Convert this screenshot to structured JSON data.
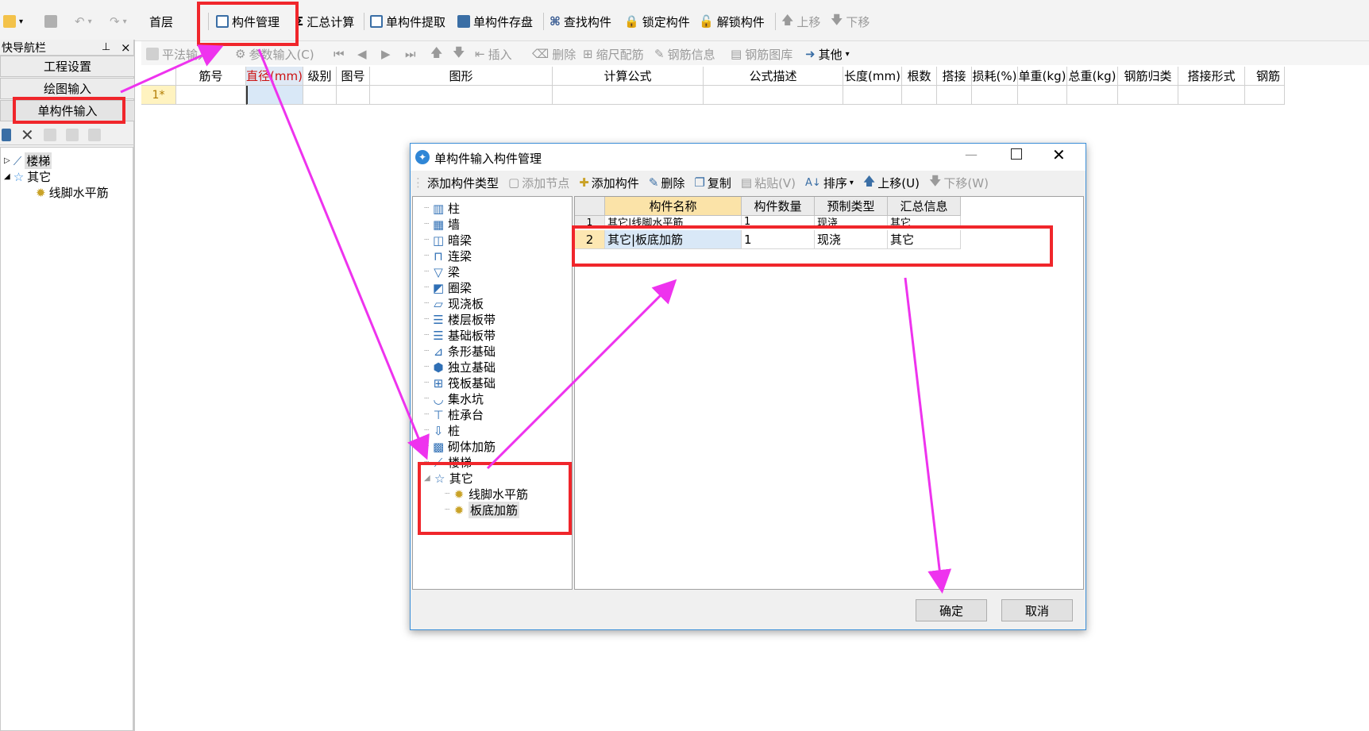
{
  "toolbar": {
    "floor": "首层",
    "component_manage": "构件管理",
    "summary_calc": "汇总计算",
    "single_extract": "单构件提取",
    "single_save": "单构件存盘",
    "find_component": "查找构件",
    "lock_component": "锁定构件",
    "unlock_component": "解锁构件",
    "move_up": "上移",
    "move_down": "下移"
  },
  "nav": {
    "title": "快导航栏",
    "pin": "ᵖ",
    "close": "×",
    "items": [
      "工程设置",
      "绘图输入",
      "单构件输入"
    ],
    "tree": [
      {
        "label": "楼梯"
      },
      {
        "label": "其它"
      },
      {
        "label": "线脚水平筋"
      }
    ]
  },
  "toolbar2": {
    "items": [
      "平法输入",
      "参数输入(C)",
      "插入",
      "删除",
      "缩尺配筋",
      "钢筋信息",
      "钢筋图库",
      "其他"
    ]
  },
  "grid": {
    "headers": [
      "筋号",
      "直径(mm)",
      "级别",
      "图号",
      "图形",
      "计算公式",
      "公式描述",
      "长度(mm)",
      "根数",
      "搭接",
      "损耗(%)",
      "单重(kg)",
      "总重(kg)",
      "钢筋归类",
      "搭接形式",
      "钢筋"
    ],
    "row_marker": "1*"
  },
  "dialog": {
    "title": "单构件输入构件管理",
    "toolbar": [
      "添加构件类型",
      "添加节点",
      "添加构件",
      "删除",
      "复制",
      "粘贴(V)",
      "排序",
      "上移(U)",
      "下移(W)"
    ],
    "tree": [
      "柱",
      "墙",
      "暗梁",
      "连梁",
      "梁",
      "圈梁",
      "现浇板",
      "楼层板带",
      "基础板带",
      "条形基础",
      "独立基础",
      "筏板基础",
      "集水坑",
      "桩承台",
      "桩",
      "砌体加筋",
      "楼梯",
      "其它",
      "线脚水平筋",
      "板底加筋"
    ],
    "table": {
      "headers": [
        "构件名称",
        "构件数量",
        "预制类型",
        "汇总信息"
      ],
      "rows": [
        {
          "num": "1",
          "name": "其它|线脚水平筋",
          "count": "1",
          "type": "现浇",
          "summary": "其它"
        },
        {
          "num": "2",
          "name": "其它|板底加筋",
          "count": "1",
          "type": "现浇",
          "summary": "其它"
        }
      ]
    },
    "ok": "确定",
    "cancel": "取消"
  },
  "colors": {
    "annotation_red": "#f0262b",
    "annotation_arrow": "#ee33ee",
    "selected_cell": "#d9e8f7",
    "row_header": "#fff3c0"
  }
}
